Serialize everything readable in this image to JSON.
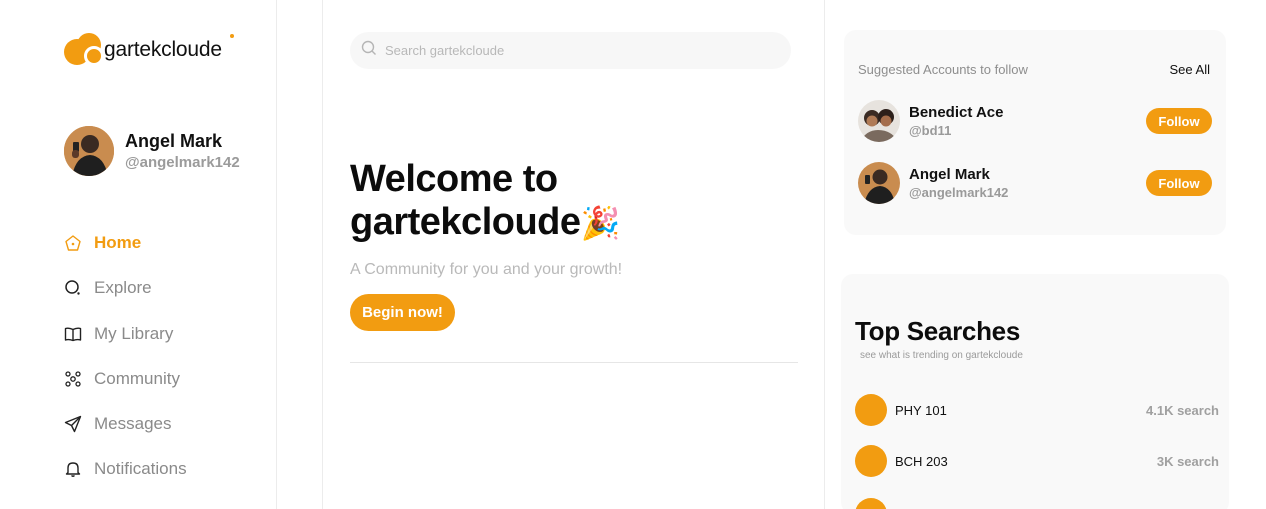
{
  "brand": {
    "name": "gartekcloude",
    "accent_color": "#f29c11"
  },
  "user": {
    "name": "Angel Mark",
    "handle": "@angelmark142"
  },
  "nav": [
    {
      "label": "Home",
      "icon": "home-icon",
      "active": true
    },
    {
      "label": "Explore",
      "icon": "explore-icon",
      "active": false
    },
    {
      "label": "My Library",
      "icon": "book-icon",
      "active": false
    },
    {
      "label": "Community",
      "icon": "community-icon",
      "active": false
    },
    {
      "label": "Messages",
      "icon": "send-icon",
      "active": false
    },
    {
      "label": "Notifications",
      "icon": "bell-icon",
      "active": false
    }
  ],
  "search": {
    "placeholder": "Search gartekcloude"
  },
  "hero": {
    "title_line1": "Welcome to",
    "title_line2": "gartekcloude",
    "emoji": "🎉",
    "subtitle": "A Community for you and your growth!",
    "cta": "Begin now!"
  },
  "suggested": {
    "heading": "Suggested Accounts to follow",
    "see_all": "See All",
    "accounts": [
      {
        "name": "Benedict Ace",
        "handle": "@bd11",
        "button": "Follow"
      },
      {
        "name": "Angel Mark",
        "handle": "@angelmark142",
        "button": "Follow"
      }
    ]
  },
  "top_searches": {
    "title": "Top Searches",
    "subtitle": "see what is trending on gartekcloude",
    "items": [
      {
        "name": "PHY 101",
        "count": "4.1K search"
      },
      {
        "name": "BCH 203",
        "count": "3K search"
      }
    ]
  }
}
